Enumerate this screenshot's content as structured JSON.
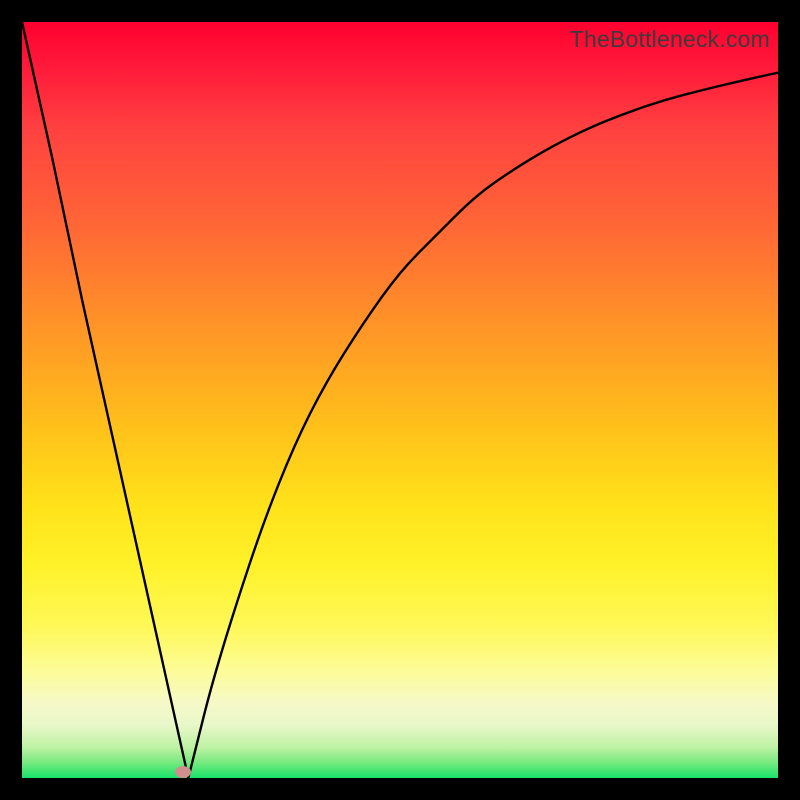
{
  "credit": "TheBottleneck.com",
  "colors": {
    "frame": "#000000",
    "curve": "#000000",
    "marker": "#cf8f8d"
  },
  "chart_data": {
    "type": "line",
    "title": "",
    "xlabel": "",
    "ylabel": "",
    "x_range_pct": [
      0,
      100
    ],
    "y_range_pct": [
      0,
      100
    ],
    "series": [
      {
        "name": "curve",
        "x_pct": [
          0,
          4,
          8,
          12,
          16,
          18,
          20,
          21,
          22,
          23,
          25,
          28,
          32,
          36,
          40,
          45,
          50,
          55,
          60,
          65,
          70,
          75,
          80,
          85,
          90,
          95,
          100
        ],
        "y_pct": [
          100,
          82,
          63,
          45,
          27,
          18,
          9,
          4.5,
          0,
          4,
          12,
          22,
          34,
          44,
          52,
          60,
          67,
          72,
          77,
          80.5,
          83.5,
          86,
          88,
          89.7,
          91,
          92.2,
          93.3
        ],
        "note": "y is measured from bottom of the plot area; piecewise V-shaped curve with minimum near x≈22%"
      }
    ],
    "marker": {
      "x_pct": 21.3,
      "y_pct": 0.8
    }
  }
}
